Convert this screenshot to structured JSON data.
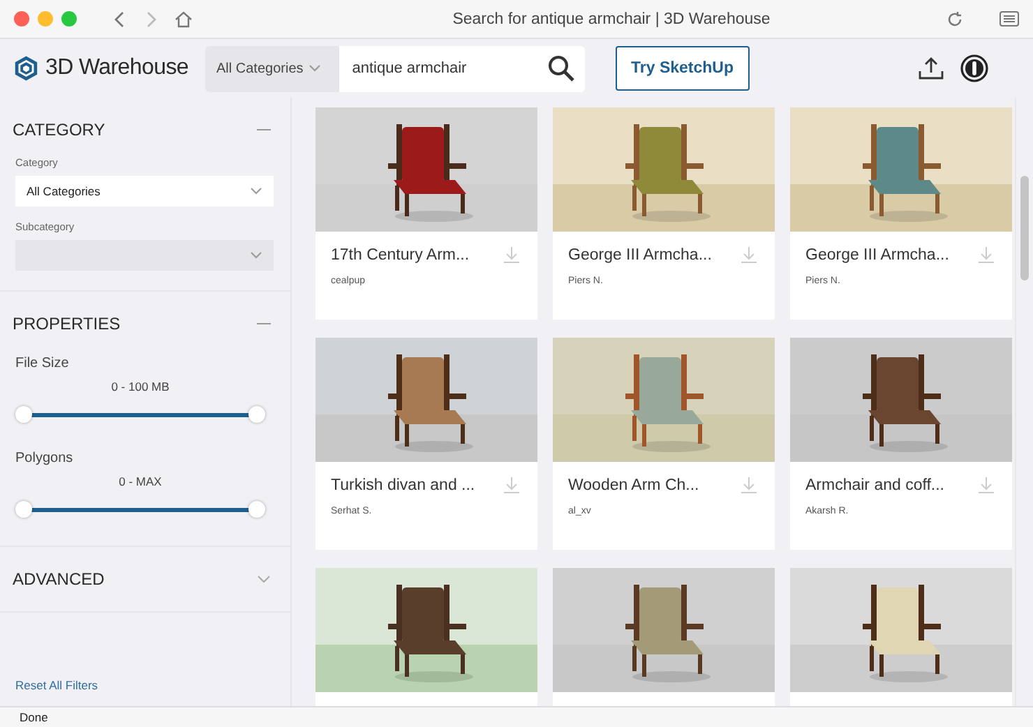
{
  "browser": {
    "title": "Search for antique armchair | 3D Warehouse"
  },
  "header": {
    "logo": "3D Warehouse",
    "category_select": "All Categories",
    "search_value": "antique armchair",
    "cta": "Try SketchUp"
  },
  "sidebar": {
    "sections": [
      {
        "title": "CATEGORY",
        "expanded": true,
        "kind": "category",
        "fields": [
          {
            "label": "Category",
            "value": "All Categories",
            "disabled": false
          },
          {
            "label": "Subcategory",
            "disabled": true
          }
        ]
      },
      {
        "title": "PROPERTIES",
        "expanded": true,
        "kind": "properties",
        "sliders": [
          {
            "label": "File Size",
            "reading": "0 - 100 MB",
            "level": 1
          },
          {
            "label": "Polygons",
            "reading": "0 - MAX",
            "level": 1
          }
        ]
      },
      {
        "title": "ADVANCED",
        "expanded": false
      }
    ],
    "reset": "Reset All Filters"
  },
  "results": [
    {
      "title": "17th Century Arm...",
      "author": "cealpup"
    },
    {
      "title": "George III Armcha...",
      "author": "Piers N."
    },
    {
      "title": "George III Armcha...",
      "author": "Piers N."
    },
    {
      "title": "Turkish divan and ...",
      "author": "Serhat S."
    },
    {
      "title": "Wooden Arm Ch...",
      "author": "al_xv"
    },
    {
      "title": "Armchair and coff...",
      "author": "Akarsh R."
    },
    {
      "kind": "picture"
    },
    {
      "kind": "picture"
    },
    {
      "kind": "picture"
    }
  ],
  "status_bar": {
    "text": "Done"
  }
}
